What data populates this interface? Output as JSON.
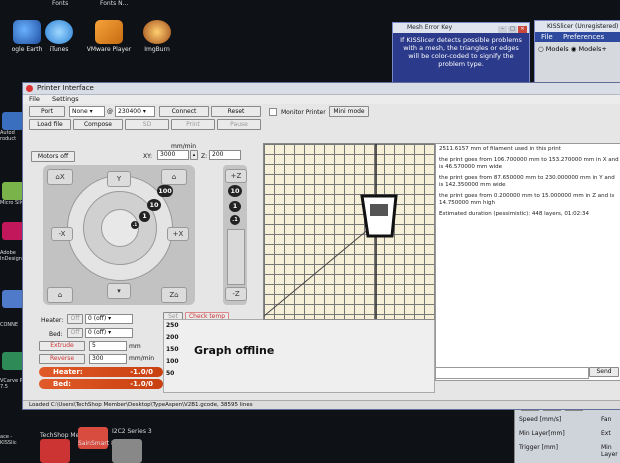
{
  "desktop": {
    "top_labels": [
      "Fonts",
      "Fonts N..."
    ],
    "icons": [
      {
        "name": "google-earth",
        "label": "ogle Earth"
      },
      {
        "name": "itunes",
        "label": "iTunes"
      },
      {
        "name": "vmware",
        "label": "VMware Player"
      },
      {
        "name": "imgburn",
        "label": "ImgBurn"
      }
    ],
    "side_labels": [
      "Autod roduct",
      "Micro Silve",
      "Adobe InDesign",
      "CONNE",
      "VCarve Pro 7.5",
      "ace - KISSlic"
    ],
    "bottom_labels": [
      "TechShop Member...",
      "SainSmart 8...",
      "I2C2 Series 3"
    ]
  },
  "mesh_error_key": {
    "title": "Mesh Error Key",
    "text": "If KISSlicer detects possible problems with a mesh, the triangles or edges will be color-coded to signify the problem type."
  },
  "kisslicer": {
    "title": "KISSlicer (Unregistered)",
    "menu": [
      "File",
      "Preferences"
    ],
    "radios": [
      "Models",
      "Models+"
    ]
  },
  "right_panel": {
    "rows": [
      "Speed [mm/s]",
      "Min Layer[mm]",
      "Trigger [mm]"
    ],
    "values": [
      "2",
      "25",
      "75"
    ],
    "labels": [
      "Fan",
      "Ext",
      "Min Layer"
    ]
  },
  "printer": {
    "title": "Printer Interface",
    "menu": [
      "File",
      "Settings"
    ],
    "port_button": "Port",
    "port_value": "None",
    "at": "@",
    "baud_value": "230400",
    "connect": "Connect",
    "reset": "Reset",
    "monitor_printer": "Monitor Printer",
    "mini_mode": "Mini mode",
    "load_file": "Load file",
    "compose": "Compose",
    "sd": "SD",
    "print": "Print",
    "pause": "Pause",
    "motors_off": "Motors off",
    "mm_min": "mm/min",
    "xy_label": "XY:",
    "xy_value": "3000",
    "z_label": "Z:",
    "z_value": "200",
    "jog_labels": {
      "home_x": "X",
      "home_y": "Y",
      "minus_x": "-X",
      "plus_x": "+X",
      "home_z": "Z",
      "z_plus": "+Z",
      "z_minus": "-Z"
    },
    "jog_dots": [
      "100",
      "10",
      "1",
      ".1",
      "100",
      "10",
      "1",
      ".1"
    ],
    "z_dots": [
      "10",
      "1",
      ".1"
    ],
    "heater_label": "Heater:",
    "bed_label": "Bed:",
    "heater_value": "0 (off)",
    "bed_value": "0 (off)",
    "set_label": "Set",
    "off_label": "Off",
    "check_temp": "Check temp",
    "extrude": "Extrude",
    "extrude_value": "5",
    "reverse": "Reverse",
    "reverse_value": "300",
    "mm_unit": "mm",
    "mm_min_unit": "mm/min",
    "graph_axis": [
      "250",
      "200",
      "150",
      "100",
      "50"
    ],
    "graph_offline": "Graph offline",
    "heater_bar": "Heater:",
    "heater_bar_val": "-1.0/0",
    "bed_bar": "Bed:",
    "bed_bar_val": "-1.0/0",
    "output": [
      "2511.6157 mm of filament used in this print",
      "the print goes from 106.700000 mm to 153.270000 mm in X and is 46.570000 mm wide",
      "the print goes from 87.650000 mm to 230.000000 mm in Y and is 142.350000 mm wide",
      "the print goes from 0.200000 mm to 15.000000 mm in Z and is 14.750000 mm high",
      "Estimated duration (pessimistic): 448 layers, 01:02:34"
    ],
    "send": "Send",
    "status": "Loaded C:\\Users\\TechShop Member\\Desktop\\TypeAspen\\V2B1.gcode, 38595 lines"
  }
}
